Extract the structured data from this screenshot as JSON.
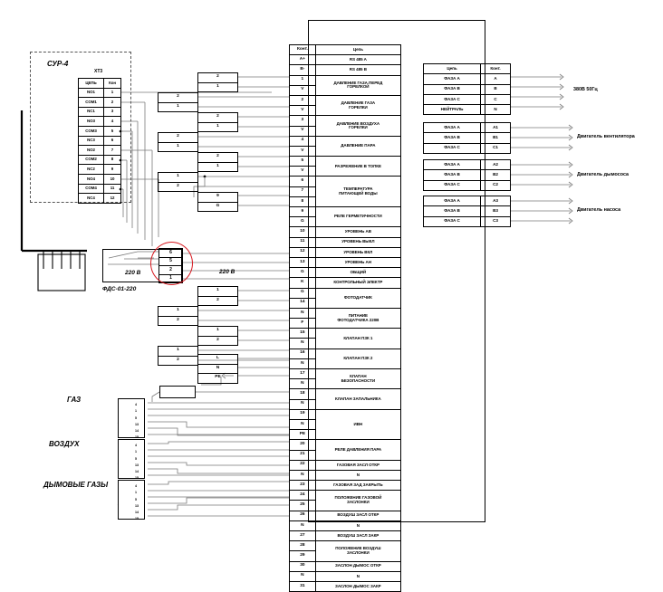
{
  "diagram": {
    "title_blocks": {
      "sur4": "СУР-4",
      "xt3": "XT3",
      "fds": "ФДС-01-220",
      "voltage_left": "220 В",
      "voltage_right": "220 В"
    },
    "xt3_table": {
      "headers": [
        "ЦЕПЬ",
        "Кон"
      ],
      "rows": [
        {
          "circuit": "NO1",
          "contact": "1"
        },
        {
          "circuit": "COM1",
          "contact": "2"
        },
        {
          "circuit": "NC1",
          "contact": "3"
        },
        {
          "circuit": "NO3",
          "contact": "4"
        },
        {
          "circuit": "COM3",
          "contact": "5"
        },
        {
          "circuit": "NC3",
          "contact": "6"
        },
        {
          "circuit": "NO2",
          "contact": "7"
        },
        {
          "circuit": "COM2",
          "contact": "8"
        },
        {
          "circuit": "NC2",
          "contact": "9"
        },
        {
          "circuit": "NO4",
          "contact": "10"
        },
        {
          "circuit": "COM4",
          "contact": "11"
        },
        {
          "circuit": "NC4",
          "contact": "12"
        }
      ]
    },
    "main_table": {
      "headers": [
        "Конт.",
        "Цепь"
      ],
      "rows": [
        {
          "contact": "A+",
          "circuit": "RS 485 A",
          "span": 1
        },
        {
          "contact": "B-",
          "circuit": "RS 485 B",
          "span": 1
        },
        {
          "contact": "1",
          "circuit": "ДАВЛЕНИЕ ГАЗА ПЕРЕД\nГОРЕЛКОЙ",
          "span": 2
        },
        {
          "contact": "V",
          "circuit": "",
          "span": 0
        },
        {
          "contact": "2",
          "circuit": "ДАВЛЕНИЕ ГАЗА\nГОРЕЛКИ",
          "span": 2
        },
        {
          "contact": "V",
          "circuit": "",
          "span": 0
        },
        {
          "contact": "3",
          "circuit": "ДАВЛЕНИЕ ВОЗДУХА\nГОРЕЛКИ",
          "span": 2
        },
        {
          "contact": "V",
          "circuit": "",
          "span": 0
        },
        {
          "contact": "4",
          "circuit": "ДАВЛЕНИЕ ПАРА",
          "span": 2
        },
        {
          "contact": "V",
          "circuit": "",
          "span": 0
        },
        {
          "contact": "5",
          "circuit": "РАЗРЕЖЕНИЕ В ТОПКЕ",
          "span": 2
        },
        {
          "contact": "V",
          "circuit": "",
          "span": 0
        },
        {
          "contact": "6",
          "circuit": "ТЕМПЕРАТУРА\nПИТАЮЩЕЙ ВОДЫ",
          "span": 3
        },
        {
          "contact": "7",
          "circuit": "",
          "span": 0
        },
        {
          "contact": "8",
          "circuit": "",
          "span": 0
        },
        {
          "contact": "9",
          "circuit": "РЕЛЕ ГЕРМЕТИЧНОСТИ",
          "span": 2
        },
        {
          "contact": "G",
          "circuit": "",
          "span": 0
        },
        {
          "contact": "10",
          "circuit": "УРОВЕНЬ АВ",
          "span": 1
        },
        {
          "contact": "11",
          "circuit": "УРОВЕНЬ ВЫКЛ",
          "span": 1
        },
        {
          "contact": "12",
          "circuit": "УРОВЕНЬ ВКЛ",
          "span": 1
        },
        {
          "contact": "13",
          "circuit": "УРОВЕНЬ АН",
          "span": 1
        },
        {
          "contact": "G",
          "circuit": "ОБЩИЙ",
          "span": 1
        },
        {
          "contact": "K",
          "circuit": "КОНТРОЛЬНЫЙ ЭЛЕКТР",
          "span": 1
        },
        {
          "contact": "G",
          "circuit": "ФОТОДАТЧИК",
          "span": 2
        },
        {
          "contact": "14",
          "circuit": "",
          "span": 0
        },
        {
          "contact": "N",
          "circuit": "ПИТАНИЕ\nФОТОДАТЧИКА 220В",
          "span": 2
        },
        {
          "contact": "F",
          "circuit": "",
          "span": 0
        },
        {
          "contact": "15",
          "circuit": "КЛАПАН ПЗК 1",
          "span": 2
        },
        {
          "contact": "N",
          "circuit": "",
          "span": 0
        },
        {
          "contact": "16",
          "circuit": "КЛАПАН ПЗК 2",
          "span": 2
        },
        {
          "contact": "N",
          "circuit": "",
          "span": 0
        },
        {
          "contact": "17",
          "circuit": "КЛАПАН\nБЕЗОПАСНОСТИ",
          "span": 2
        },
        {
          "contact": "N",
          "circuit": "",
          "span": 0
        },
        {
          "contact": "18",
          "circuit": "КЛАПАН ЗАПАЛЬНИКА",
          "span": 2
        },
        {
          "contact": "N",
          "circuit": "",
          "span": 0
        },
        {
          "contact": "19",
          "circuit": "ИВН",
          "span": 3
        },
        {
          "contact": "N",
          "circuit": "",
          "span": 0
        },
        {
          "contact": "PE",
          "circuit": "",
          "span": 0
        },
        {
          "contact": "20",
          "circuit": "РЕЛЕ ДАВЛЕНИЯ ПАРА",
          "span": 2
        },
        {
          "contact": "21",
          "circuit": "",
          "span": 0
        },
        {
          "contact": "22",
          "circuit": "ГАЗОВАЯ ЗАСЛ ОТКР",
          "span": 1
        },
        {
          "contact": "N",
          "circuit": "N",
          "span": 1
        },
        {
          "contact": "23",
          "circuit": "ГАЗОВАЯ ЗАД ЗАКРЫТЬ",
          "span": 1
        },
        {
          "contact": "24",
          "circuit": "ПОЛОЖЕНИЕ ГАЗОВОЙ\nЗАСЛОНКИ",
          "span": 2
        },
        {
          "contact": "25",
          "circuit": "",
          "span": 0
        },
        {
          "contact": "26",
          "circuit": "ВОЗДУШ ЗАСЛ ОТКР",
          "span": 1
        },
        {
          "contact": "N",
          "circuit": "N",
          "span": 1
        },
        {
          "contact": "27",
          "circuit": "ВОЗДУШ ЗАСЛ ЗАКР",
          "span": 1
        },
        {
          "contact": "28",
          "circuit": "ПОЛОЖЕНИЕ ВОЗДУШ\nЗАСЛОНКИ",
          "span": 2
        },
        {
          "contact": "29",
          "circuit": "",
          "span": 0
        },
        {
          "contact": "30",
          "circuit": "ЗАСЛОН ДЫМОС ОТКР",
          "span": 1
        },
        {
          "contact": "N",
          "circuit": "N",
          "span": 1
        },
        {
          "contact": "31",
          "circuit": "ЗАСЛОН ДЫМОС ЗАКР",
          "span": 1
        }
      ]
    },
    "power_tables": {
      "headers": [
        "Цепь",
        "Конт."
      ],
      "groups": [
        {
          "label": "380В 50Гц",
          "rows": [
            {
              "circuit": "ФАЗА A",
              "contact": "A"
            },
            {
              "circuit": "ФАЗА B",
              "contact": "B"
            },
            {
              "circuit": "ФАЗА C",
              "contact": "C"
            },
            {
              "circuit": "НЕЙТРАЛЬ",
              "contact": "N"
            }
          ]
        },
        {
          "label": "Двигатель вентилятора",
          "rows": [
            {
              "circuit": "ФАЗА A",
              "contact": "A1"
            },
            {
              "circuit": "ФАЗА B",
              "contact": "B1"
            },
            {
              "circuit": "ФАЗА C",
              "contact": "C1"
            }
          ]
        },
        {
          "label": "Двигатель дымососа",
          "rows": [
            {
              "circuit": "ФАЗА A",
              "contact": "A2"
            },
            {
              "circuit": "ФАЗА B",
              "contact": "B2"
            },
            {
              "circuit": "ФАЗА C",
              "contact": "C2"
            }
          ]
        },
        {
          "label": "Двигатель насоса",
          "rows": [
            {
              "circuit": "ФАЗА A",
              "contact": "A3"
            },
            {
              "circuit": "ФАЗА B",
              "contact": "B3"
            },
            {
              "circuit": "ФАЗА C",
              "contact": "C3"
            }
          ]
        }
      ]
    },
    "sensor_terminals": [
      {
        "top": "2",
        "bottom": "1"
      },
      {
        "top": "2",
        "bottom": "1"
      },
      {
        "top": "2",
        "bottom": "1"
      },
      {
        "top": "2",
        "bottom": "1"
      },
      {
        "top": "2",
        "bottom": "1"
      },
      {
        "top": "1",
        "bottom": "2"
      },
      {
        "top": "9",
        "bottom": "G"
      }
    ],
    "valve_terminals": [
      {
        "top": "1",
        "bottom": "2"
      },
      {
        "top": "1",
        "bottom": "2"
      },
      {
        "top": "1",
        "bottom": "2"
      },
      {
        "top": "1",
        "bottom": "2"
      },
      {
        "top": "L",
        "mid": "N",
        "bottom": "PE"
      }
    ],
    "fds_terminals": [
      "6",
      "5",
      "2",
      "1"
    ],
    "actuators": [
      {
        "label": "ГАЗ",
        "pins": [
          "4",
          "1",
          "5",
          "13",
          "14",
          "15"
        ]
      },
      {
        "label": "ВОЗДУХ",
        "pins": [
          "4",
          "1",
          "5",
          "13",
          "14",
          "15"
        ]
      },
      {
        "label": "ДЫМОВЫЕ ГАЗЫ",
        "pins": [
          "4",
          "1",
          "5",
          "13",
          "14",
          "15"
        ]
      }
    ],
    "colors": {
      "wire": "#7a7a7a",
      "line": "#000000",
      "highlight": "#d81920",
      "background": "#ffffff"
    }
  }
}
